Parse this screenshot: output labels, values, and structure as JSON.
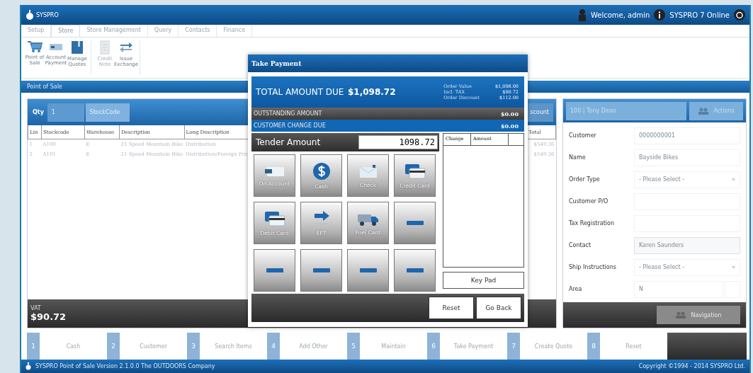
{
  "header": {
    "logo": "SYSPRO",
    "welcome": "Welcome, admin",
    "status": "SYSPRO 7 Online"
  },
  "ribbon_tabs": [
    {
      "label": "Setup",
      "selected": false
    },
    {
      "label": "Store",
      "selected": true
    },
    {
      "label": "Store Management",
      "selected": false
    },
    {
      "label": "Query",
      "selected": false
    },
    {
      "label": "Contacts",
      "selected": false
    },
    {
      "label": "Finance",
      "selected": false
    }
  ],
  "ribbon_buttons": [
    {
      "label": "Point of Sale",
      "kind": "cart",
      "disabled": false
    },
    {
      "label": "Account Payment",
      "kind": "card",
      "disabled": false
    },
    {
      "label": "Manage Quotes",
      "kind": "book",
      "disabled": false
    },
    {
      "label": "Credit Note",
      "kind": "document",
      "disabled": true
    },
    {
      "label": "Issue Exchange",
      "kind": "exchange",
      "disabled": false
    }
  ],
  "section_title": "Point of Sale",
  "entry": {
    "qty_label": "Qty",
    "qty": "1",
    "stockcode_placeholder": "StockCode",
    "discount": "scount"
  },
  "table": {
    "columns": [
      "Lin",
      "Stockcode",
      "Warehouse",
      "Description",
      "Long Description",
      "Total"
    ],
    "rows": [
      [
        "1",
        "A100",
        "E",
        "21 Speed Mountain Bike",
        "Distribution",
        "$549.36"
      ],
      [
        "2",
        "A101",
        "E",
        "21 Speed Mountain Bike",
        "Distribution/Foreign Pric",
        "$549.36"
      ]
    ]
  },
  "totals": {
    "label": "VAT",
    "value": "$90.72"
  },
  "customer_panel": {
    "account": "100 | Tony Dean",
    "actions": "Actions",
    "fields": [
      {
        "label": "Customer",
        "kind": "text",
        "value": "0000000001"
      },
      {
        "label": "Name",
        "kind": "text",
        "value": "Bayside Bikes"
      },
      {
        "label": "Order Type",
        "kind": "select",
        "placeholder": "- Please Select -"
      },
      {
        "label": "Customer P/O",
        "kind": "text"
      },
      {
        "label": "Tax Registration",
        "kind": "text"
      },
      {
        "label": "Contact",
        "kind": "boxed",
        "value": "Karen Saunders"
      },
      {
        "label": "Ship Instructions",
        "kind": "select",
        "placeholder": "- Please Select -"
      },
      {
        "label": "Area",
        "kind": "lookup",
        "value": "N"
      }
    ],
    "navigation": "Navigation"
  },
  "function_keys": [
    {
      "number": "1",
      "label": "Cash"
    },
    {
      "number": "2",
      "label": "Customer"
    },
    {
      "number": "3",
      "label": "Search Items"
    },
    {
      "number": "4",
      "label": "Add Other"
    },
    {
      "number": "5",
      "label": "Maintain"
    },
    {
      "number": "6",
      "label": "Take Payment"
    },
    {
      "number": "7",
      "label": "Create Quote"
    },
    {
      "number": "8",
      "label": "Reset"
    }
  ],
  "status_bar": {
    "left": "SYSPRO Point of Sale Version 2.1.0.0 The OUTDOORS Company",
    "right": "Copyright ©1994 - 2014 SYSPRO Ltd."
  },
  "dialog": {
    "title": "Take Payment",
    "total_label": "TOTAL AMOUNT DUE",
    "total_value": "$1,098.72",
    "breakdown": [
      {
        "label": "Order Value",
        "value": "$1,098.00"
      },
      {
        "label": "Incl. TAX",
        "value": "$90.72"
      },
      {
        "label": "Order Discount",
        "value": "$112.00"
      }
    ],
    "outstanding_label": "OUTSTANDING AMOUNT",
    "outstanding_value": "$0.00",
    "change_label": "CUSTOMER CHANGE DUE",
    "change_value": "$0.00",
    "tender_label": "Tender Amount",
    "tender_value": "1098.72",
    "tender_columns": [
      "Change",
      "Amount"
    ],
    "methods": [
      {
        "kind": "account",
        "label": "On Account"
      },
      {
        "kind": "cash",
        "label": "Cash"
      },
      {
        "kind": "check",
        "label": "Check"
      },
      {
        "kind": "credit",
        "label": "Credit Card"
      },
      {
        "kind": "debit",
        "label": "Debit Card"
      },
      {
        "kind": "eft",
        "label": "EFT"
      },
      {
        "kind": "fuel",
        "label": "Fuel Card"
      },
      {
        "kind": "empty"
      },
      {
        "kind": "empty"
      },
      {
        "kind": "empty"
      },
      {
        "kind": "empty"
      },
      {
        "kind": "empty"
      }
    ],
    "keypad": "Key Pad",
    "buttons": [
      "Reset",
      "Go Back"
    ]
  }
}
